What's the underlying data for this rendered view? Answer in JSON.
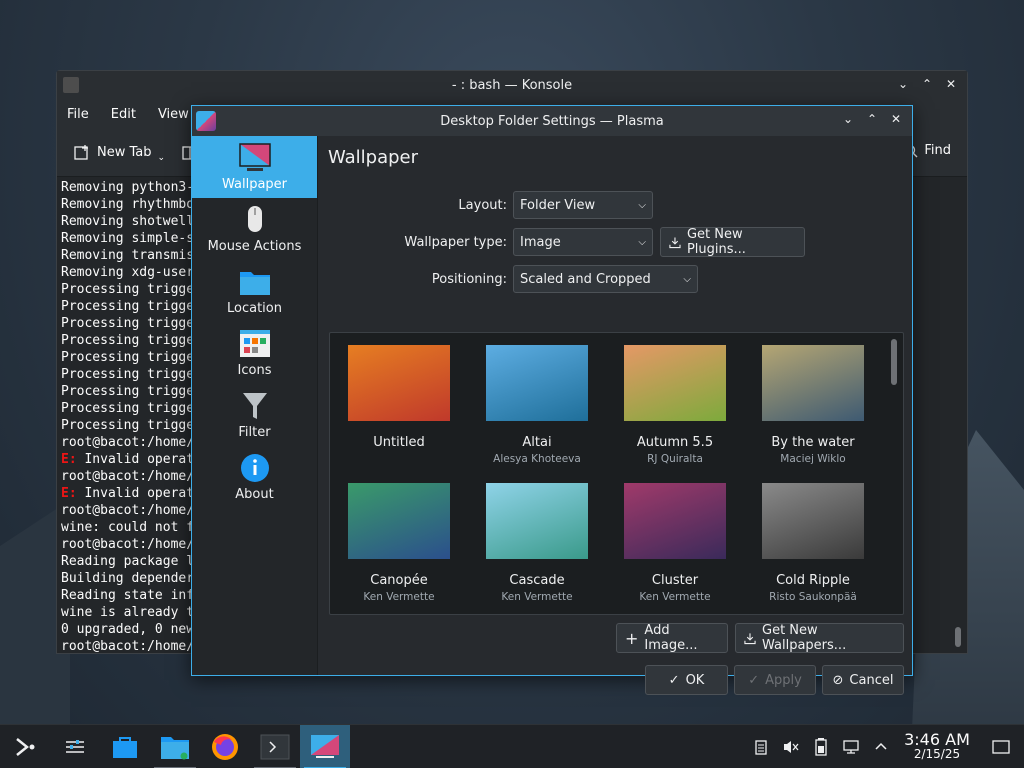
{
  "konsole": {
    "title": "- : bash — Konsole",
    "menu": [
      "File",
      "Edit",
      "View"
    ],
    "new_tab": "New Tab",
    "find": "Find",
    "lines": [
      {
        "t": "Removing python3-"
      },
      {
        "t": "Removing rhythmbo"
      },
      {
        "t": "Removing shotwell"
      },
      {
        "t": "Removing simple-s"
      },
      {
        "t": "Removing transmis"
      },
      {
        "t": "Removing xdg-user"
      },
      {
        "t": "Processing trigge"
      },
      {
        "t": "Processing trigge"
      },
      {
        "t": "Processing trigge"
      },
      {
        "t": "Processing trigge"
      },
      {
        "t": "Processing trigge"
      },
      {
        "t": "Processing trigge"
      },
      {
        "t": "Processing trigge"
      },
      {
        "t": "Processing trigge"
      },
      {
        "t": "Processing trigge"
      },
      {
        "t": "root@bacot:/home/"
      },
      {
        "e": "E:",
        "t": " Invalid operat"
      },
      {
        "t": "root@bacot:/home/"
      },
      {
        "e": "E:",
        "t": " Invalid operat"
      },
      {
        "t": "root@bacot:/home/"
      },
      {
        "t": "wine: could not f"
      },
      {
        "t": "root@bacot:/home/"
      },
      {
        "t": "Reading package l"
      },
      {
        "t": "Building depender"
      },
      {
        "t": "Reading state inf"
      },
      {
        "t": "wine is already t"
      },
      {
        "t": "0 upgraded, 0 new"
      },
      {
        "t": "root@bacot:/home/"
      }
    ]
  },
  "dialog": {
    "title": "Desktop Folder Settings — Plasma",
    "sidebar": [
      {
        "label": "Wallpaper",
        "icon": "monitor-icon",
        "active": true
      },
      {
        "label": "Mouse Actions",
        "icon": "mouse-icon",
        "active": false
      },
      {
        "label": "Location",
        "icon": "folder-icon",
        "active": false
      },
      {
        "label": "Icons",
        "icon": "icons-grid-icon",
        "active": false
      },
      {
        "label": "Filter",
        "icon": "filter-icon",
        "active": false
      },
      {
        "label": "About",
        "icon": "info-icon",
        "active": false
      }
    ],
    "page_title": "Wallpaper",
    "layout_label": "Layout:",
    "layout_value": "Folder View",
    "type_label": "Wallpaper type:",
    "type_value": "Image",
    "get_plugins": "Get New Plugins...",
    "pos_label": "Positioning:",
    "pos_value": "Scaled and Cropped",
    "wallpapers": [
      {
        "name": "Untitled",
        "author": "",
        "colors": [
          "#e67e22",
          "#c0392b"
        ]
      },
      {
        "name": "Altai",
        "author": "Alesya Khoteeva",
        "colors": [
          "#5dade2",
          "#1f6f9a"
        ]
      },
      {
        "name": "Autumn 5.5",
        "author": "RJ Quiralta",
        "colors": [
          "#e59866",
          "#7daa3c"
        ]
      },
      {
        "name": "By the water",
        "author": "Maciej Wiklo",
        "colors": [
          "#b5a673",
          "#3e5a72"
        ]
      },
      {
        "name": "Canopée",
        "author": "Ken Vermette",
        "colors": [
          "#3a9a6a",
          "#2b4f8c"
        ]
      },
      {
        "name": "Cascade",
        "author": "Ken Vermette",
        "colors": [
          "#8fd3e8",
          "#3a9a8a"
        ]
      },
      {
        "name": "Cluster",
        "author": "Ken Vermette",
        "colors": [
          "#a03a6a",
          "#3a2a5a"
        ]
      },
      {
        "name": "Cold Ripple",
        "author": "Risto Saukonpää",
        "colors": [
          "#8a8a8a",
          "#3a3a3a"
        ]
      }
    ],
    "add_image": "Add Image...",
    "get_wallpapers": "Get New Wallpapers...",
    "ok": "OK",
    "apply": "Apply",
    "cancel": "Cancel"
  },
  "taskbar": {
    "time": "3:46 AM",
    "date": "2/15/25"
  },
  "colors": {
    "accent": "#3daee9",
    "error": "#ed1515"
  }
}
